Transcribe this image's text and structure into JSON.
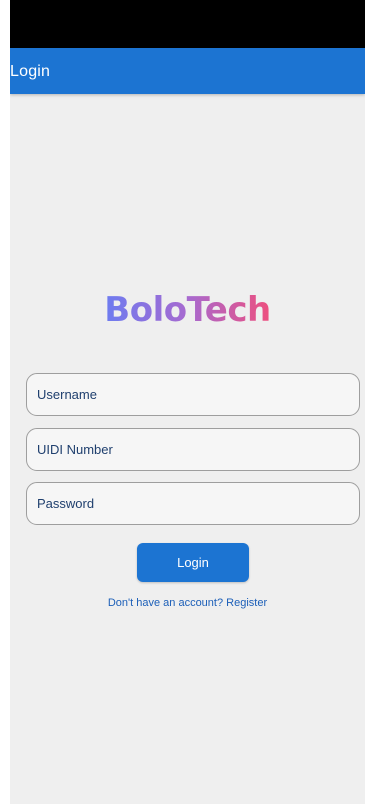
{
  "app_bar": {
    "title": "Login"
  },
  "logo": {
    "text": "BoloTech"
  },
  "form": {
    "username_placeholder": "Username",
    "uidi_placeholder": "UIDI Number",
    "password_placeholder": "Password",
    "username_value": "",
    "uidi_value": "",
    "password_value": "",
    "login_label": "Login",
    "register_text": "Don't have an account? Register"
  },
  "colors": {
    "primary": "#1c74d2",
    "background": "#efefef",
    "status_bar": "#000000",
    "logo_gradient_start": "#6d7cf0",
    "logo_gradient_end": "#ee4f7e"
  }
}
